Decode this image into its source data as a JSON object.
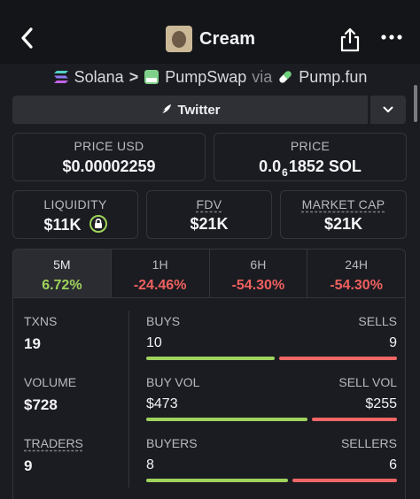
{
  "header": {
    "title": "Cream",
    "back_icon": "chevron-left-icon",
    "share_icon": "share-icon",
    "more_icon": "more-dots-icon"
  },
  "breadcrumb": {
    "chain": "Solana",
    "separator": ">",
    "dex": "PumpSwap",
    "via": "via",
    "launchpad": "Pump.fun"
  },
  "social": {
    "twitter_label": "Twitter",
    "dropdown_icon": "chevron-down-icon"
  },
  "price": {
    "usd_label": "PRICE USD",
    "usd_value": "$0.00002259",
    "native_label": "PRICE",
    "native_prefix": "0.0",
    "native_zeros": "6",
    "native_rest": "1852 SOL"
  },
  "metrics": {
    "liquidity_label": "LIQUIDITY",
    "liquidity_value": "$11K",
    "fdv_label": "FDV",
    "fdv_value": "$21K",
    "mcap_label": "MARKET CAP",
    "mcap_value": "$21K"
  },
  "timeframes": [
    {
      "label": "5M",
      "change": "6.72%"
    },
    {
      "label": "1H",
      "change": "-24.46%"
    },
    {
      "label": "6H",
      "change": "-54.30%"
    },
    {
      "label": "24H",
      "change": "-54.30%"
    }
  ],
  "stats": {
    "txns_label": "TXNS",
    "txns_value": "19",
    "buys_label": "BUYS",
    "buys_value": "10",
    "sells_label": "SELLS",
    "sells_value": "9",
    "volume_label": "VOLUME",
    "volume_value": "$728",
    "buy_vol_label": "BUY VOL",
    "buy_vol_value": "$473",
    "sell_vol_label": "SELL VOL",
    "sell_vol_value": "$255",
    "traders_label": "TRADERS",
    "traders_value": "9",
    "buyers_label": "BUYERS",
    "buyers_value": "8",
    "sellers_label": "SELLERS",
    "sellers_value": "6"
  },
  "colors": {
    "positive": "#9ed35a",
    "negative": "#f0605f",
    "background": "#1b1c21"
  }
}
